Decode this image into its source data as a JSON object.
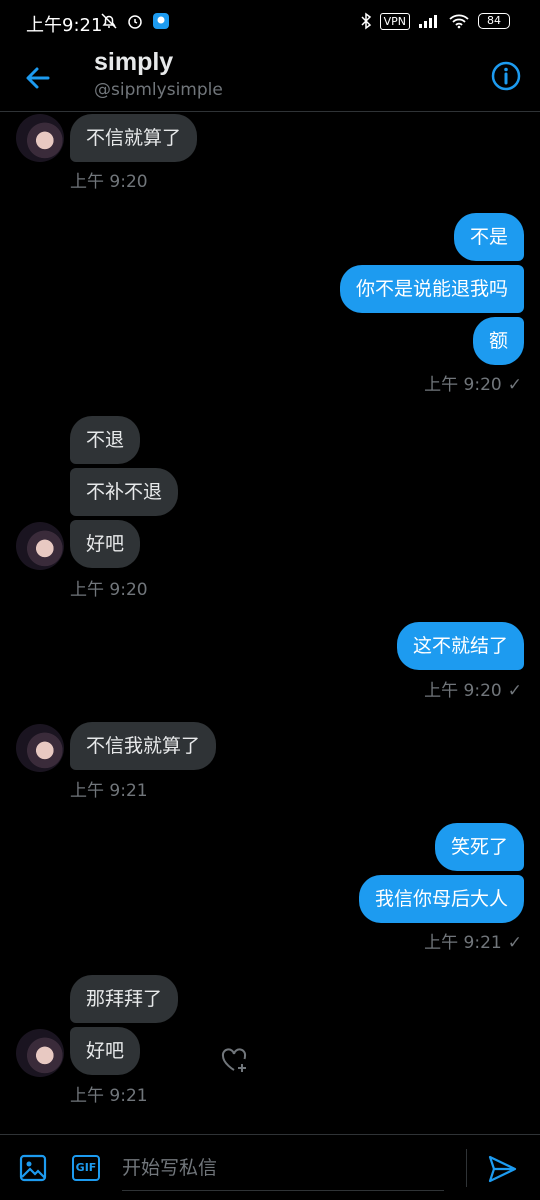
{
  "status_bar": {
    "time": "上午9:21",
    "vpn": "VPN",
    "battery": "84"
  },
  "header": {
    "title": "simply",
    "handle": "@sipmlysimple"
  },
  "messages": [
    {
      "text": "不信就算了",
      "dir": "in"
    },
    {
      "text": "不是",
      "dir": "out"
    },
    {
      "text": "你不是说能退我吗",
      "dir": "out"
    },
    {
      "text": "额",
      "dir": "out"
    },
    {
      "text": "不退",
      "dir": "in"
    },
    {
      "text": "不补不退",
      "dir": "in"
    },
    {
      "text": "好吧",
      "dir": "in"
    },
    {
      "text": "这不就结了",
      "dir": "out"
    },
    {
      "text": "不信我就算了",
      "dir": "in"
    },
    {
      "text": "笑死了",
      "dir": "out"
    },
    {
      "text": "我信你母后大人",
      "dir": "out"
    },
    {
      "text": "那拜拜了",
      "dir": "in"
    },
    {
      "text": "好吧",
      "dir": "in"
    }
  ],
  "timestamps": [
    {
      "text": "上午 9:20",
      "seen": false
    },
    {
      "text": "上午 9:20",
      "seen": true
    },
    {
      "text": "上午 9:20",
      "seen": false
    },
    {
      "text": "上午 9:20",
      "seen": true
    },
    {
      "text": "上午 9:21",
      "seen": false
    },
    {
      "text": "上午 9:21",
      "seen": true
    },
    {
      "text": "上午 9:21",
      "seen": false
    }
  ],
  "composer": {
    "placeholder": "开始写私信",
    "gif_label": "GIF"
  },
  "colors": {
    "accent": "#1d9bf0",
    "incoming_bubble": "#2f3336",
    "background": "#000000",
    "muted_text": "#71767b"
  },
  "icons": [
    "back-arrow-icon",
    "info-icon",
    "heart-plus-icon",
    "image-icon",
    "gif-icon",
    "send-icon"
  ]
}
